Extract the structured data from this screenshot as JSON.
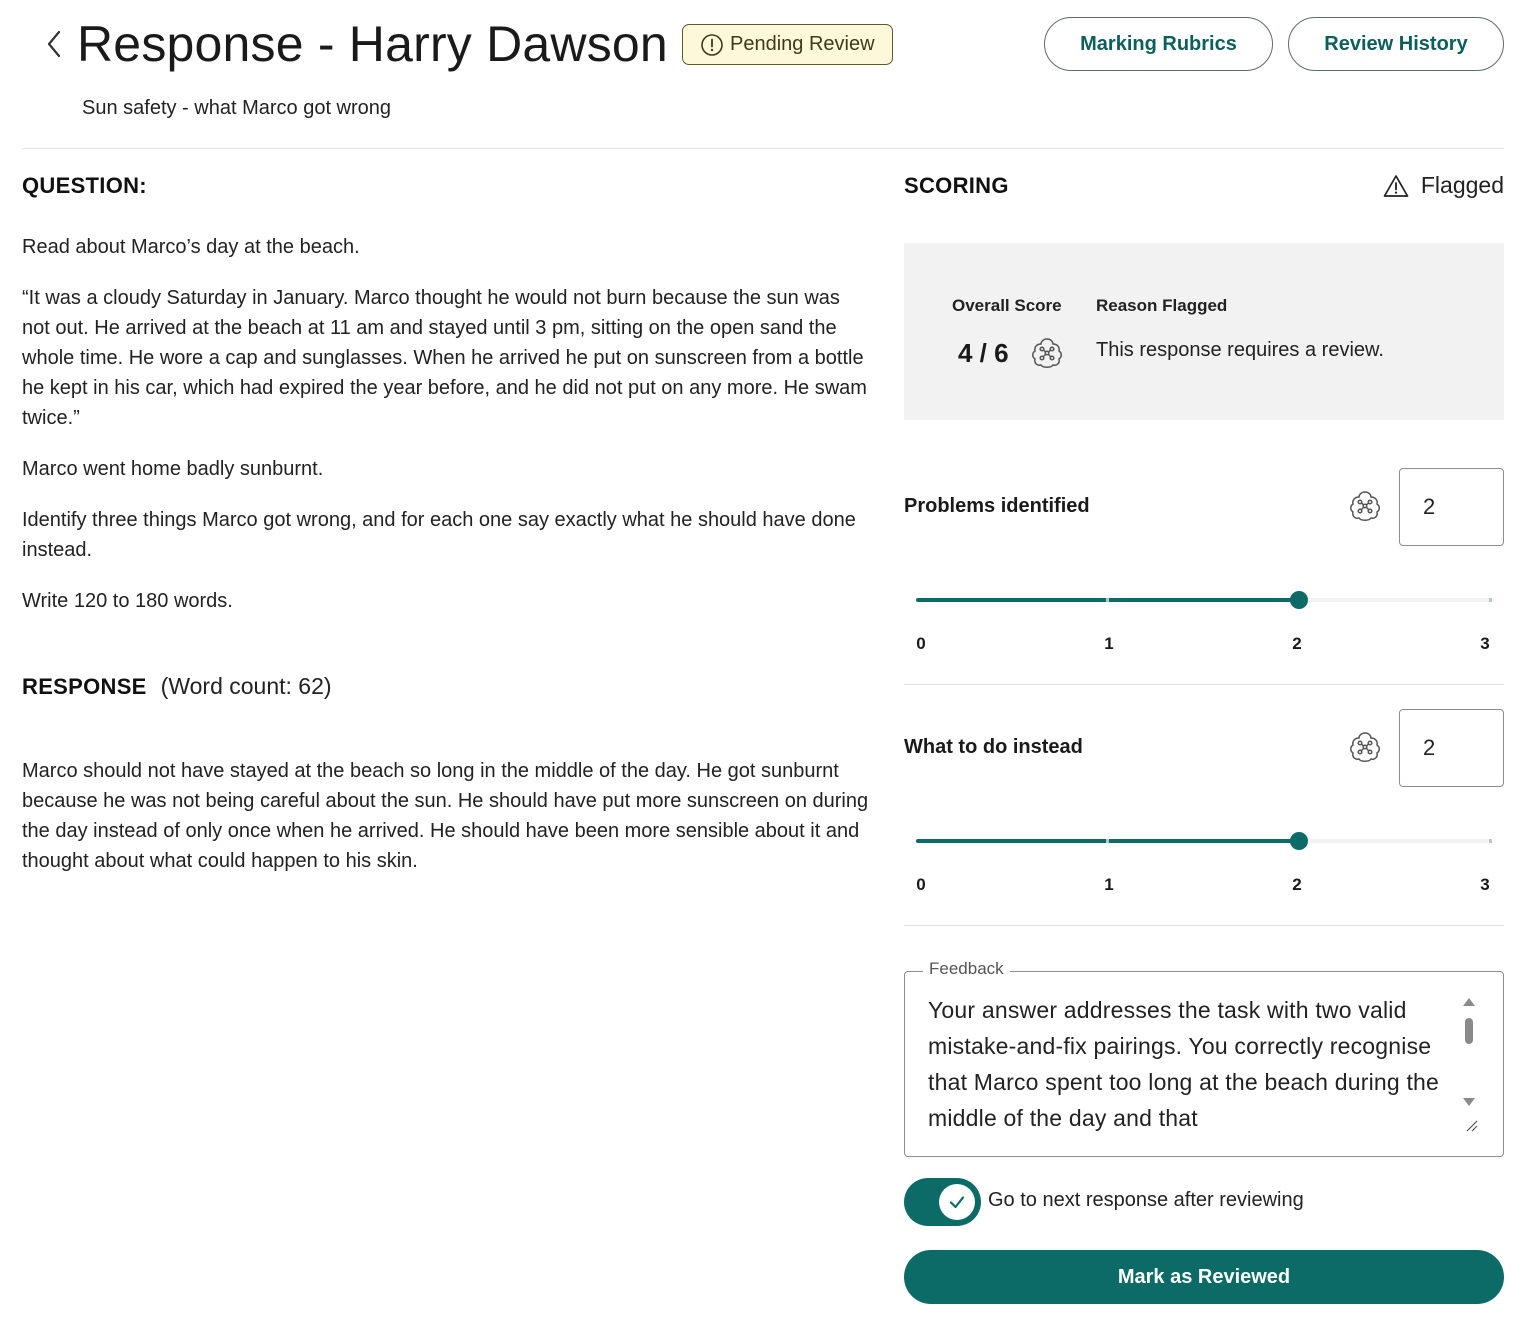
{
  "header": {
    "title": "Response - Harry Dawson",
    "status": "Pending Review",
    "subtitle": "Sun safety - what Marco got wrong",
    "buttons": {
      "rubrics": "Marking Rubrics",
      "history": "Review History"
    }
  },
  "question": {
    "heading": "QUESTION:",
    "paragraphs": [
      "Read about Marco’s day at the beach.",
      "“It was a cloudy Saturday in January. Marco thought he would not burn because the sun was not out. He arrived at the beach at 11 am and stayed until 3 pm, sitting on the open sand the whole time. He wore a cap and sunglasses. When he arrived he put on sunscreen from a bottle he kept in his car, which had expired the year before, and he did not put on any more. He swam twice.”",
      "Marco went home badly sunburnt.",
      "Identify three things Marco got wrong, and for each one say exactly what he should have done instead.",
      "Write 120 to 180 words."
    ]
  },
  "response": {
    "heading": "RESPONSE",
    "word_count": "(Word count: 62)",
    "text": "Marco should not have stayed at the beach so long in the middle of the day. He got sunburnt because he was not being careful about the sun. He should have put more sunscreen on during the day instead of only once when he arrived. He should have been more sensible about it and thought about what could happen to his skin."
  },
  "scoring": {
    "heading": "SCORING",
    "flagged_label": "Flagged",
    "overall_score_label": "Overall Score",
    "overall_score": "4 / 6",
    "reason_label": "Reason Flagged",
    "reason": "This response requires a review.",
    "criteria": [
      {
        "label": "Problems identified",
        "value": "2",
        "level": 2,
        "max": 3,
        "ticks": [
          "0",
          "1",
          "2",
          "3"
        ]
      },
      {
        "label": "What to do instead",
        "value": "2",
        "level": 2,
        "max": 3,
        "ticks": [
          "0",
          "1",
          "2",
          "3"
        ]
      }
    ]
  },
  "feedback": {
    "label": "Feedback",
    "text": "Your answer addresses the task with two valid mistake-and-fix pairings. You correctly recognise that Marco spent too long at the beach during the middle of the day and that"
  },
  "toggle": {
    "label": "Go to next response after reviewing",
    "checked": true
  },
  "primary_action": "Mark as Reviewed",
  "icons": {
    "back": "chevron-left-icon",
    "status": "alert-circle-icon",
    "flag": "warning-triangle-icon",
    "ai": "ai-chip-icon",
    "toggle_check": "check-icon"
  },
  "colors": {
    "accent": "#0c6b66",
    "badge_bg": "#fdf8da",
    "panel_bg": "#f2f2f2"
  }
}
